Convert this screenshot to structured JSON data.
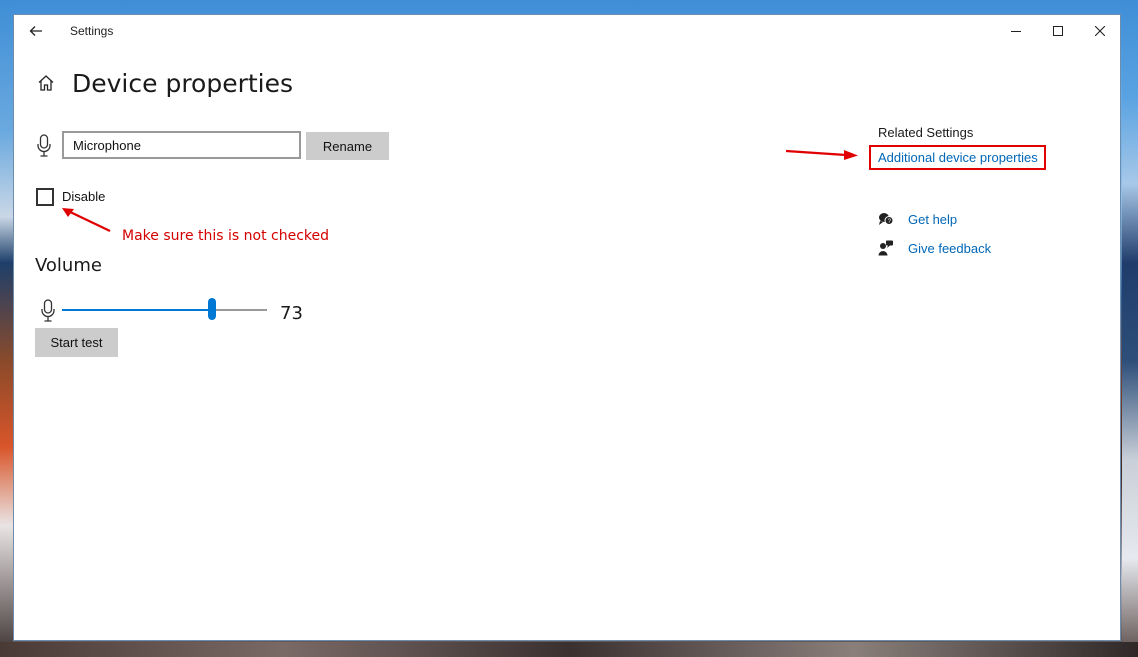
{
  "window": {
    "title": "Settings"
  },
  "header": {
    "title": "Device properties"
  },
  "device": {
    "name_value": "Microphone",
    "rename_label": "Rename",
    "disable_label": "Disable",
    "disable_checked": false
  },
  "annotation": {
    "note": "Make sure this is not checked",
    "color": "#d40000"
  },
  "volume": {
    "heading": "Volume",
    "level": 73,
    "start_test_label": "Start test"
  },
  "related": {
    "heading": "Related Settings",
    "additional_link": "Additional device properties",
    "get_help": "Get help",
    "give_feedback": "Give feedback"
  },
  "colors": {
    "accent": "#0078d4",
    "link": "#0067b8",
    "annotation": "#e00000"
  },
  "icons": {
    "back": "back-arrow-icon",
    "home": "home-icon",
    "microphone": "microphone-icon",
    "help": "help-chat-icon",
    "feedback": "feedback-person-icon"
  }
}
